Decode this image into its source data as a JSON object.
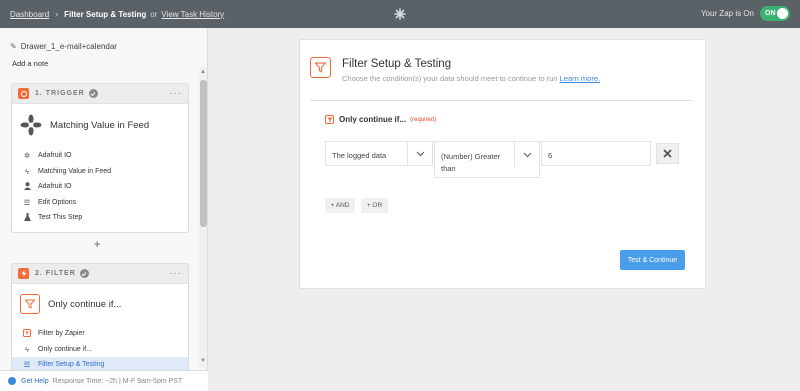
{
  "topbar": {
    "dashboard_link": "Dashboard",
    "separator": "›",
    "title": "Filter Setup & Testing",
    "or_text": "or",
    "history_link": "View Task History",
    "zap_status": "Your Zap is On",
    "toggle_label": "ON"
  },
  "sidebar": {
    "zap_name": "Drawer_1_e-mail+calendar",
    "add_note": "Add a note",
    "steps": [
      {
        "title": "1. TRIGGER",
        "app_name": "Matching Value in Feed",
        "items": [
          {
            "icon": "adafruit-icon",
            "label": "Adafruit IO"
          },
          {
            "icon": "bolt-icon",
            "label": "Matching Value in Feed"
          },
          {
            "icon": "user-icon",
            "label": "Adafruit IO"
          },
          {
            "icon": "list-icon",
            "label": "Edit Options"
          },
          {
            "icon": "flask-icon",
            "label": "Test This Step"
          }
        ]
      },
      {
        "title": "2. FILTER",
        "app_name": "Only continue if...",
        "items": [
          {
            "icon": "filter-icon",
            "label": "Filter by Zapier"
          },
          {
            "icon": "bolt-icon",
            "label": "Only continue if..."
          },
          {
            "icon": "list-icon",
            "label": "Filter Setup & Testing",
            "active": true
          }
        ]
      }
    ]
  },
  "helpbar": {
    "link": "Get Help",
    "text": "Response Time: ~2h | M-F 9am-5pm PST"
  },
  "main": {
    "title": "Filter Setup & Testing",
    "subtitle": "Choose the condition(s) your data should meet to continue to run",
    "learn_more": "Learn more.",
    "condition_label": "Only continue if...",
    "required": "(required)",
    "field_value": "The logged data",
    "operator_line1": "(Number) Greater",
    "operator_line2": "than",
    "compare_value": "6",
    "and_button": "+ AND",
    "or_button": "+ OR",
    "continue_button": "Test & Continue"
  },
  "colors": {
    "topbar": "#5b6267",
    "accent_orange": "#f26b38",
    "toggle_green": "#3bb273",
    "primary_blue": "#4a9de8",
    "active_blue": "#2e72c8"
  }
}
